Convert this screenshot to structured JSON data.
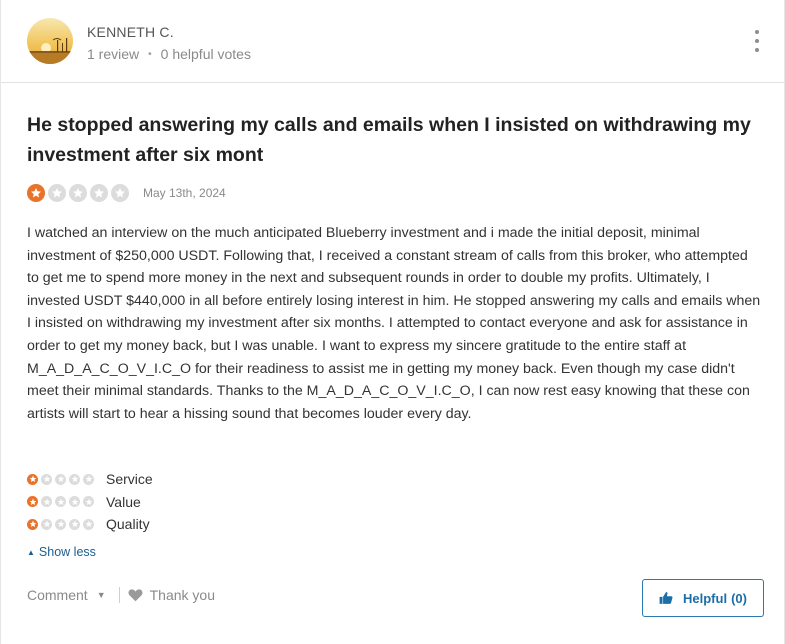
{
  "reviewer": {
    "name": "KENNETH C.",
    "reviews": "1 review",
    "helpful_votes": "0 helpful votes",
    "separator": "•"
  },
  "review": {
    "title": "He stopped answering my calls and emails when I insisted on withdrawing my investment after six mont",
    "rating": 1,
    "rating_max": 5,
    "date": "May 13th, 2024",
    "body": "I watched an interview on the much anticipated Blueberry investment and i made the initial deposit, minimal investment of $250,000 USDT. Following that, I received a constant stream of calls from this broker, who attempted to get me to spend more money in the next and subsequent rounds in order to double my profits. Ultimately, I invested USDT $440,000 in all before entirely losing interest in him. He stopped answering my calls and emails when I insisted on withdrawing my investment after six months. I attempted to contact everyone and ask for assistance in order to get my money back, but I was unable. I want to express my sincere gratitude to the entire staff at M_A_D_A_C_O_V_I.C_O for their readiness to assist me in getting my money back. Even though my case didn't meet their minimal standards. Thanks to the M_A_D_A_C_O_V_I.C_O, I can now rest easy knowing that these con artists will start to hear a hissing sound that becomes louder every day."
  },
  "sub_ratings": [
    {
      "label": "Service",
      "rating": 1
    },
    {
      "label": "Value",
      "rating": 1
    },
    {
      "label": "Quality",
      "rating": 1
    }
  ],
  "actions": {
    "show_less": "Show less",
    "comment": "Comment",
    "thank_you": "Thank you",
    "helpful": "Helpful",
    "helpful_count": "(0)"
  },
  "colors": {
    "star_filled": "#e8732b",
    "star_empty": "#dcdcdc",
    "link": "#1b5e8f",
    "helpful_border": "#2a7ab0"
  },
  "icons": {
    "kebab": "vertical-dots-icon",
    "caret_up": "caret-up-icon",
    "chevron_down": "chevron-down-icon",
    "heart": "heart-icon",
    "thumbs_up": "thumbs-up-icon",
    "star": "star-icon"
  }
}
